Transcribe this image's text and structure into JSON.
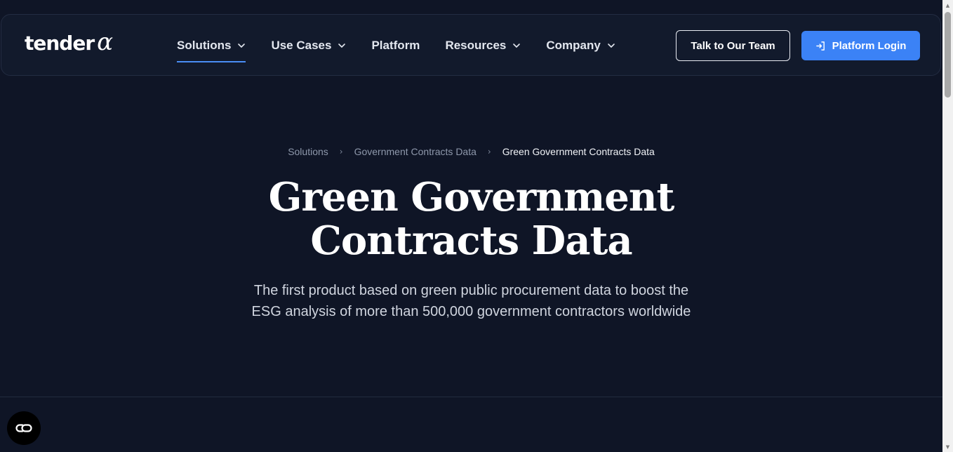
{
  "header": {
    "logo_text": "tender",
    "logo_symbol": "α",
    "nav": [
      {
        "label": "Solutions",
        "dropdown": true,
        "active": true
      },
      {
        "label": "Use Cases",
        "dropdown": true,
        "active": false
      },
      {
        "label": "Platform",
        "dropdown": false,
        "active": false
      },
      {
        "label": "Resources",
        "dropdown": true,
        "active": false
      },
      {
        "label": "Company",
        "dropdown": true,
        "active": false
      }
    ],
    "talk_button": "Talk to Our Team",
    "login_button": "Platform Login"
  },
  "breadcrumb": [
    "Solutions",
    "Government Contracts Data",
    "Green Government Contracts Data"
  ],
  "hero": {
    "title_line1": "Green Government",
    "title_line2": "Contracts Data",
    "subtitle_line1": "The first product based on green public procurement data to boost the",
    "subtitle_line2": "ESG analysis of more than 500,000 government contractors worldwide"
  },
  "colors": {
    "background": "#0f1526",
    "accent": "#3b82f6",
    "text": "#ffffff"
  },
  "icons": {
    "nav_dropdown": "chevron-down-icon",
    "login": "login-arrow-icon",
    "chat": "chat-widget-icon"
  }
}
